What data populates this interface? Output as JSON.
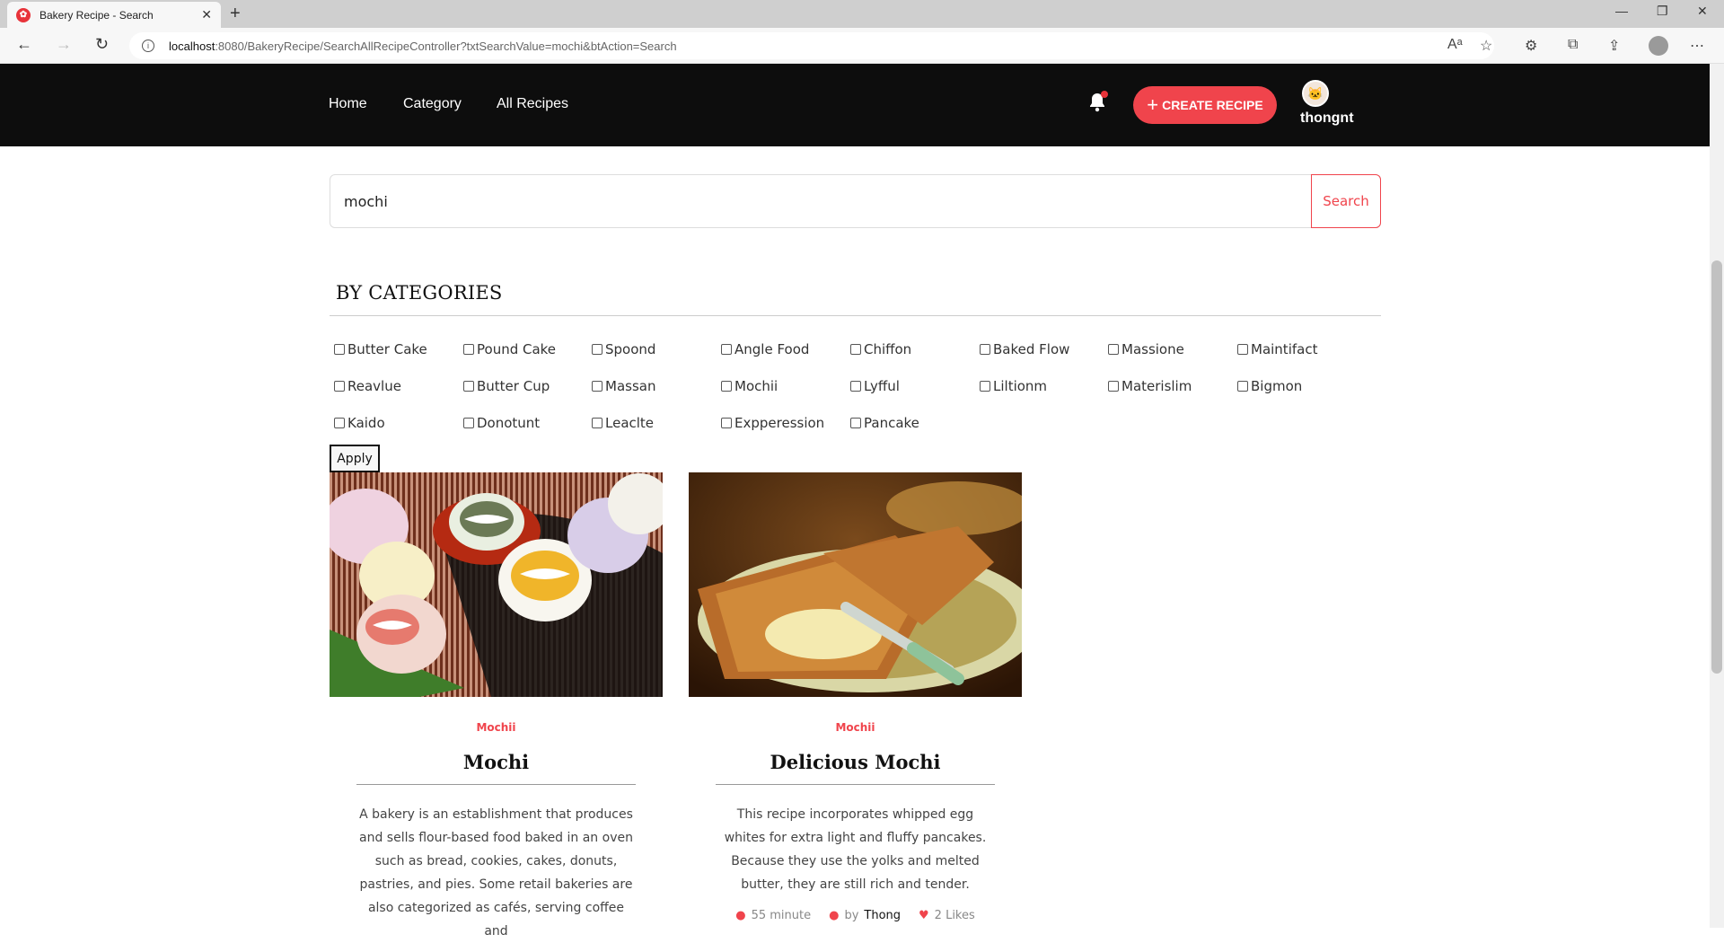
{
  "browser": {
    "tab_title": "Bakery Recipe - Search",
    "url_host": "localhost",
    "url_rest": ":8080/BakeryRecipe/SearchAllRecipeController?txtSearchValue=mochi&btAction=Search"
  },
  "header": {
    "nav": [
      "Home",
      "Category",
      "All Recipes"
    ],
    "create_label": "CREATE RECIPE",
    "username": "thongnt"
  },
  "search": {
    "value": "mochi",
    "button_label": "Search"
  },
  "categories": {
    "title": "BY CATEGORIES",
    "items": [
      "Butter Cake",
      "Pound Cake",
      "Spoond",
      "Angle Food",
      "Chiffon",
      "Baked Flow",
      "Massione",
      "Maintifact",
      "Reavlue",
      "Butter Cup",
      "Massan",
      "Mochii",
      "Lyfful",
      "Liltionm",
      "Materislim",
      "Bigmon",
      "Kaido",
      "Donotunt",
      "Leaclte",
      "Expperession",
      "Pancake"
    ],
    "apply_label": "Apply"
  },
  "recipes": [
    {
      "category": "Mochii",
      "title": "Mochi",
      "description": "A bakery is an establishment that produces and sells flour-based food baked in an oven such as bread, cookies, cakes, donuts, pastries, and pies. Some retail bakeries are also categorized as cafés, serving coffee and"
    },
    {
      "category": "Mochii",
      "title": "Delicious Mochi",
      "description": "This recipe incorporates whipped egg whites for extra light and fluffy pancakes. Because they use the yolks and melted butter, they are still rich and tender.",
      "time": "55 minute",
      "by": "by",
      "author": "Thong",
      "likes": "2 Likes"
    }
  ],
  "colors": {
    "accent": "#f0444c",
    "header_bg": "#0d0d0d"
  }
}
